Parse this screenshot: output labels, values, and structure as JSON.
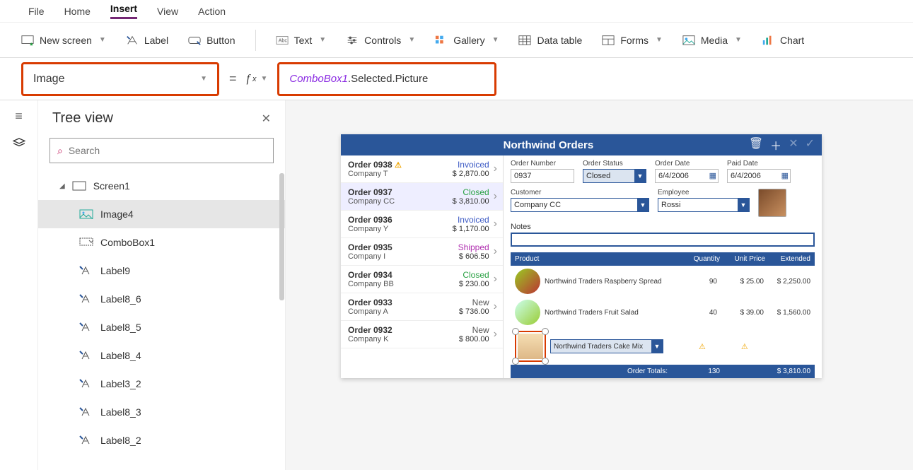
{
  "menubar": [
    "File",
    "Home",
    "Insert",
    "View",
    "Action"
  ],
  "menubar_active": 2,
  "ribbon": {
    "new_screen": "New screen",
    "label": "Label",
    "button": "Button",
    "text": "Text",
    "controls": "Controls",
    "gallery": "Gallery",
    "data_table": "Data table",
    "forms": "Forms",
    "media": "Media",
    "chart": "Chart"
  },
  "property_selector": "Image",
  "formula": {
    "ref": "ComboBox1",
    "rest": ".Selected.Picture"
  },
  "tree_panel": {
    "title": "Tree view",
    "search_placeholder": "Search",
    "root": "Screen1",
    "items": [
      {
        "icon": "image",
        "label": "Image4",
        "selected": true
      },
      {
        "icon": "combobox",
        "label": "ComboBox1"
      },
      {
        "icon": "label",
        "label": "Label9"
      },
      {
        "icon": "label",
        "label": "Label8_6"
      },
      {
        "icon": "label",
        "label": "Label8_5"
      },
      {
        "icon": "label",
        "label": "Label8_4"
      },
      {
        "icon": "label",
        "label": "Label3_2"
      },
      {
        "icon": "label",
        "label": "Label8_3"
      },
      {
        "icon": "label",
        "label": "Label8_2"
      }
    ]
  },
  "app": {
    "title": "Northwind Orders",
    "orders": [
      {
        "id": "Order 0938",
        "company": "Company T",
        "status": "Invoiced",
        "statusClass": "invoiced",
        "amount": "$ 2,870.00",
        "warn": true
      },
      {
        "id": "Order 0937",
        "company": "Company CC",
        "status": "Closed",
        "statusClass": "closed",
        "amount": "$ 3,810.00",
        "selected": true
      },
      {
        "id": "Order 0936",
        "company": "Company Y",
        "status": "Invoiced",
        "statusClass": "invoiced",
        "amount": "$ 1,170.00"
      },
      {
        "id": "Order 0935",
        "company": "Company I",
        "status": "Shipped",
        "statusClass": "shipped",
        "amount": "$ 606.50"
      },
      {
        "id": "Order 0934",
        "company": "Company BB",
        "status": "Closed",
        "statusClass": "closed",
        "amount": "$ 230.00"
      },
      {
        "id": "Order 0933",
        "company": "Company A",
        "status": "New",
        "statusClass": "new",
        "amount": "$ 736.00"
      },
      {
        "id": "Order 0932",
        "company": "Company K",
        "status": "New",
        "statusClass": "new",
        "amount": "$ 800.00"
      }
    ],
    "details": {
      "order_number_label": "Order Number",
      "order_number": "0937",
      "order_status_label": "Order Status",
      "order_status": "Closed",
      "order_date_label": "Order Date",
      "order_date": "6/4/2006",
      "paid_date_label": "Paid Date",
      "paid_date": "6/4/2006",
      "customer_label": "Customer",
      "customer": "Company CC",
      "employee_label": "Employee",
      "employee": "Rossi",
      "notes_label": "Notes",
      "notes": ""
    },
    "product_header": {
      "c1": "Product",
      "c2": "Quantity",
      "c3": "Unit Price",
      "c4": "Extended"
    },
    "products": [
      {
        "name": "Northwind Traders Raspberry Spread",
        "qty": "90",
        "unit": "$ 25.00",
        "ext": "$ 2,250.00",
        "thumb": "jam"
      },
      {
        "name": "Northwind Traders Fruit Salad",
        "qty": "40",
        "unit": "$ 39.00",
        "ext": "$ 1,560.00",
        "thumb": "salad"
      }
    ],
    "new_product_value": "Northwind Traders Cake Mix",
    "totals": {
      "label": "Order Totals:",
      "qty": "130",
      "ext": "$ 3,810.00"
    }
  }
}
